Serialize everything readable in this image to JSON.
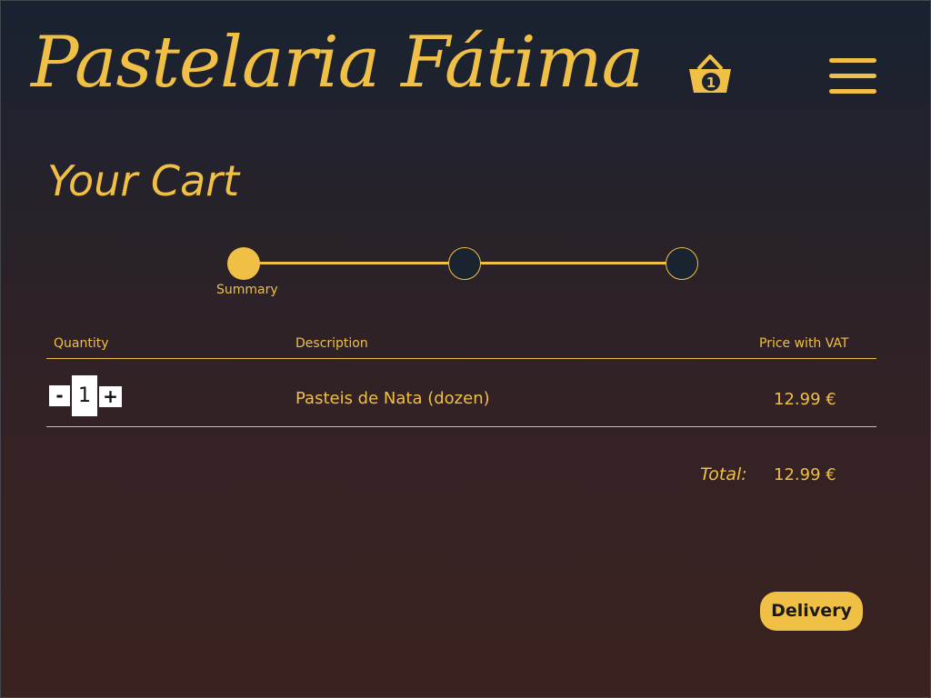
{
  "header": {
    "logo_text": "Pastelaria Fátima",
    "cart_icon": "basket-icon",
    "cart_count": "1",
    "menu_icon": "hamburger-menu-icon"
  },
  "page": {
    "title": "Your Cart"
  },
  "progress": {
    "steps": [
      {
        "label": "Summary",
        "active": true
      },
      {
        "label": "",
        "active": false
      },
      {
        "label": "",
        "active": false
      }
    ]
  },
  "table": {
    "columns": [
      "Quantity",
      "Description",
      "Price with VAT"
    ],
    "rows": [
      {
        "quantity": "1",
        "minus": "-",
        "plus": "+",
        "description": "Pasteis de Nata (dozen)",
        "price": "12.99 €"
      }
    ]
  },
  "totals": {
    "label": "Total:",
    "value": "12.99 €"
  },
  "actions": {
    "delivery_label": "Delivery"
  },
  "colors": {
    "accent": "#f0bf45",
    "background_top": "#182231",
    "background_bottom": "#3a221f"
  }
}
